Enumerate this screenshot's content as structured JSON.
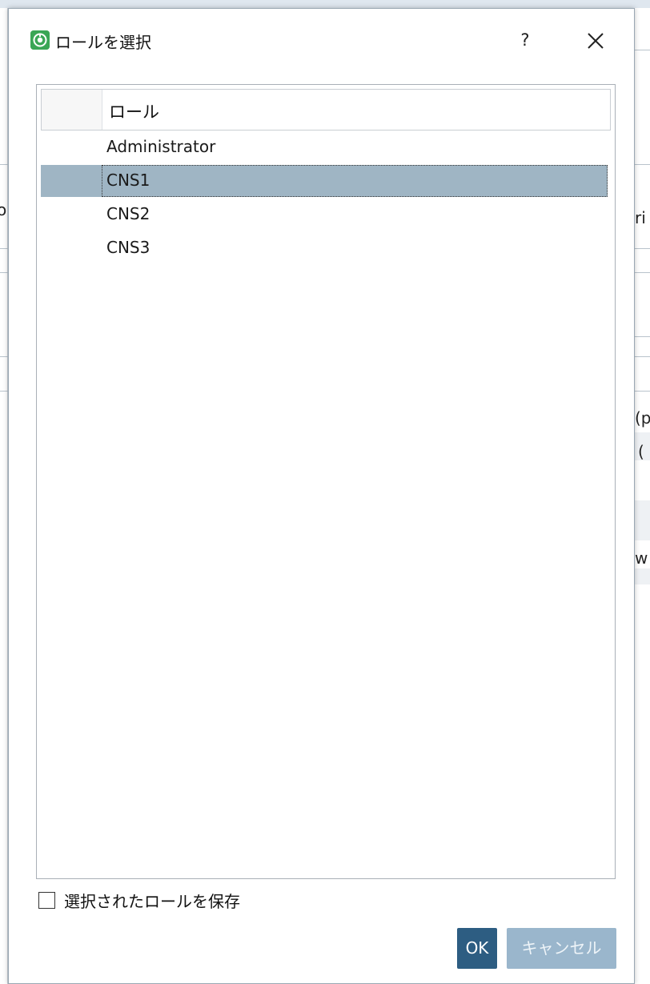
{
  "dialog": {
    "title": "ロールを選択",
    "help_label": "?",
    "list": {
      "column_header": "ロール",
      "rows": [
        "Administrator",
        "CNS1",
        "CNS2",
        "CNS3"
      ],
      "selected_index": 1
    },
    "remember_checkbox": {
      "label": "選択されたロールを保存",
      "checked": false
    },
    "ok_label": "OK",
    "cancel_label": "キャンセル"
  },
  "background": {
    "right_fragments": [
      "ri",
      "(p",
      "(",
      "w"
    ],
    "left_fragments": [
      "o"
    ]
  },
  "colors": {
    "selection": "#9fb5c4",
    "ok_button": "#2d5d82",
    "cancel_button": "#9ab6cc",
    "app_icon": "#3aa655"
  }
}
